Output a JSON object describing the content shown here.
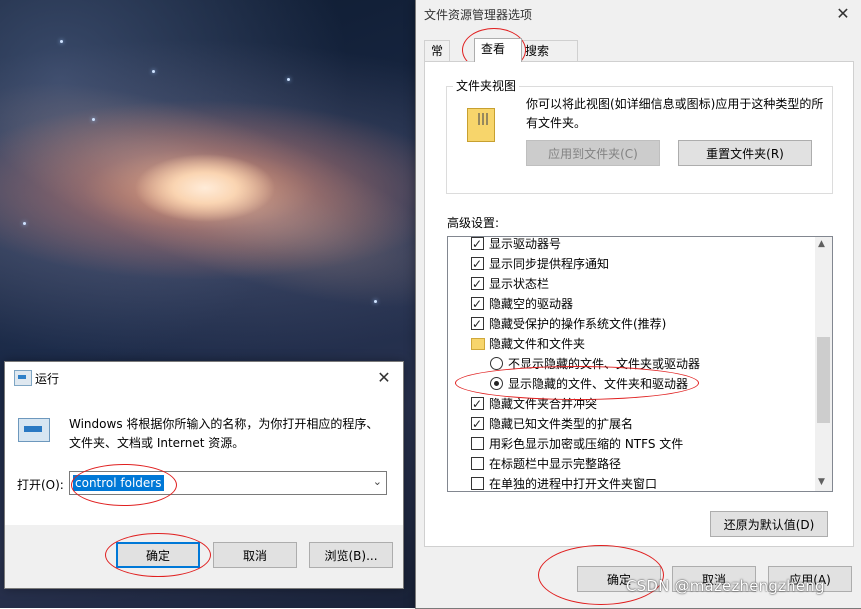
{
  "run_dialog": {
    "title": "运行",
    "description": "Windows 将根据你所输入的名称，为你打开相应的程序、文件夹、文档或 Internet 资源。",
    "open_label": "打开(O):",
    "input_value": "control folders",
    "ok_label": "确定",
    "cancel_label": "取消",
    "browse_label": "浏览(B)..."
  },
  "folder_options": {
    "title": "文件资源管理器选项",
    "tabs": [
      {
        "label": "常规"
      },
      {
        "label": "查看"
      },
      {
        "label": "搜索"
      }
    ],
    "active_tab": "查看",
    "folder_views": {
      "legend": "文件夹视图",
      "description": "你可以将此视图(如详细信息或图标)应用于这种类型的所有文件夹。",
      "apply_button": "应用到文件夹(C)",
      "reset_button": "重置文件夹(R)"
    },
    "advanced_label": "高级设置:",
    "advanced_items": [
      {
        "label": "显示驱动器号",
        "type": "checkbox",
        "checked": true
      },
      {
        "label": "显示同步提供程序通知",
        "type": "checkbox",
        "checked": true
      },
      {
        "label": "显示状态栏",
        "type": "checkbox",
        "checked": true
      },
      {
        "label": "隐藏空的驱动器",
        "type": "checkbox",
        "checked": true
      },
      {
        "label": "隐藏受保护的操作系统文件(推荐)",
        "type": "checkbox",
        "checked": true
      },
      {
        "label": "隐藏文件和文件夹",
        "type": "folder"
      },
      {
        "label": "不显示隐藏的文件、文件夹或驱动器",
        "type": "radio",
        "checked": false
      },
      {
        "label": "显示隐藏的文件、文件夹和驱动器",
        "type": "radio",
        "checked": true
      },
      {
        "label": "隐藏文件夹合并冲突",
        "type": "checkbox",
        "checked": true
      },
      {
        "label": "隐藏已知文件类型的扩展名",
        "type": "checkbox",
        "checked": true
      },
      {
        "label": "用彩色显示加密或压缩的 NTFS 文件",
        "type": "checkbox",
        "checked": false
      },
      {
        "label": "在标题栏中显示完整路径",
        "type": "checkbox",
        "checked": false
      },
      {
        "label": "在单独的进程中打开文件夹窗口",
        "type": "checkbox",
        "checked": false
      }
    ],
    "restore_defaults_button": "还原为默认值(D)",
    "ok_label": "确定",
    "cancel_label": "取消",
    "apply_label": "应用(A)"
  },
  "watermark": "CSDN @mazezhengzheng",
  "colors": {
    "accent": "#0078d7",
    "annotation_red": "#e02020"
  }
}
